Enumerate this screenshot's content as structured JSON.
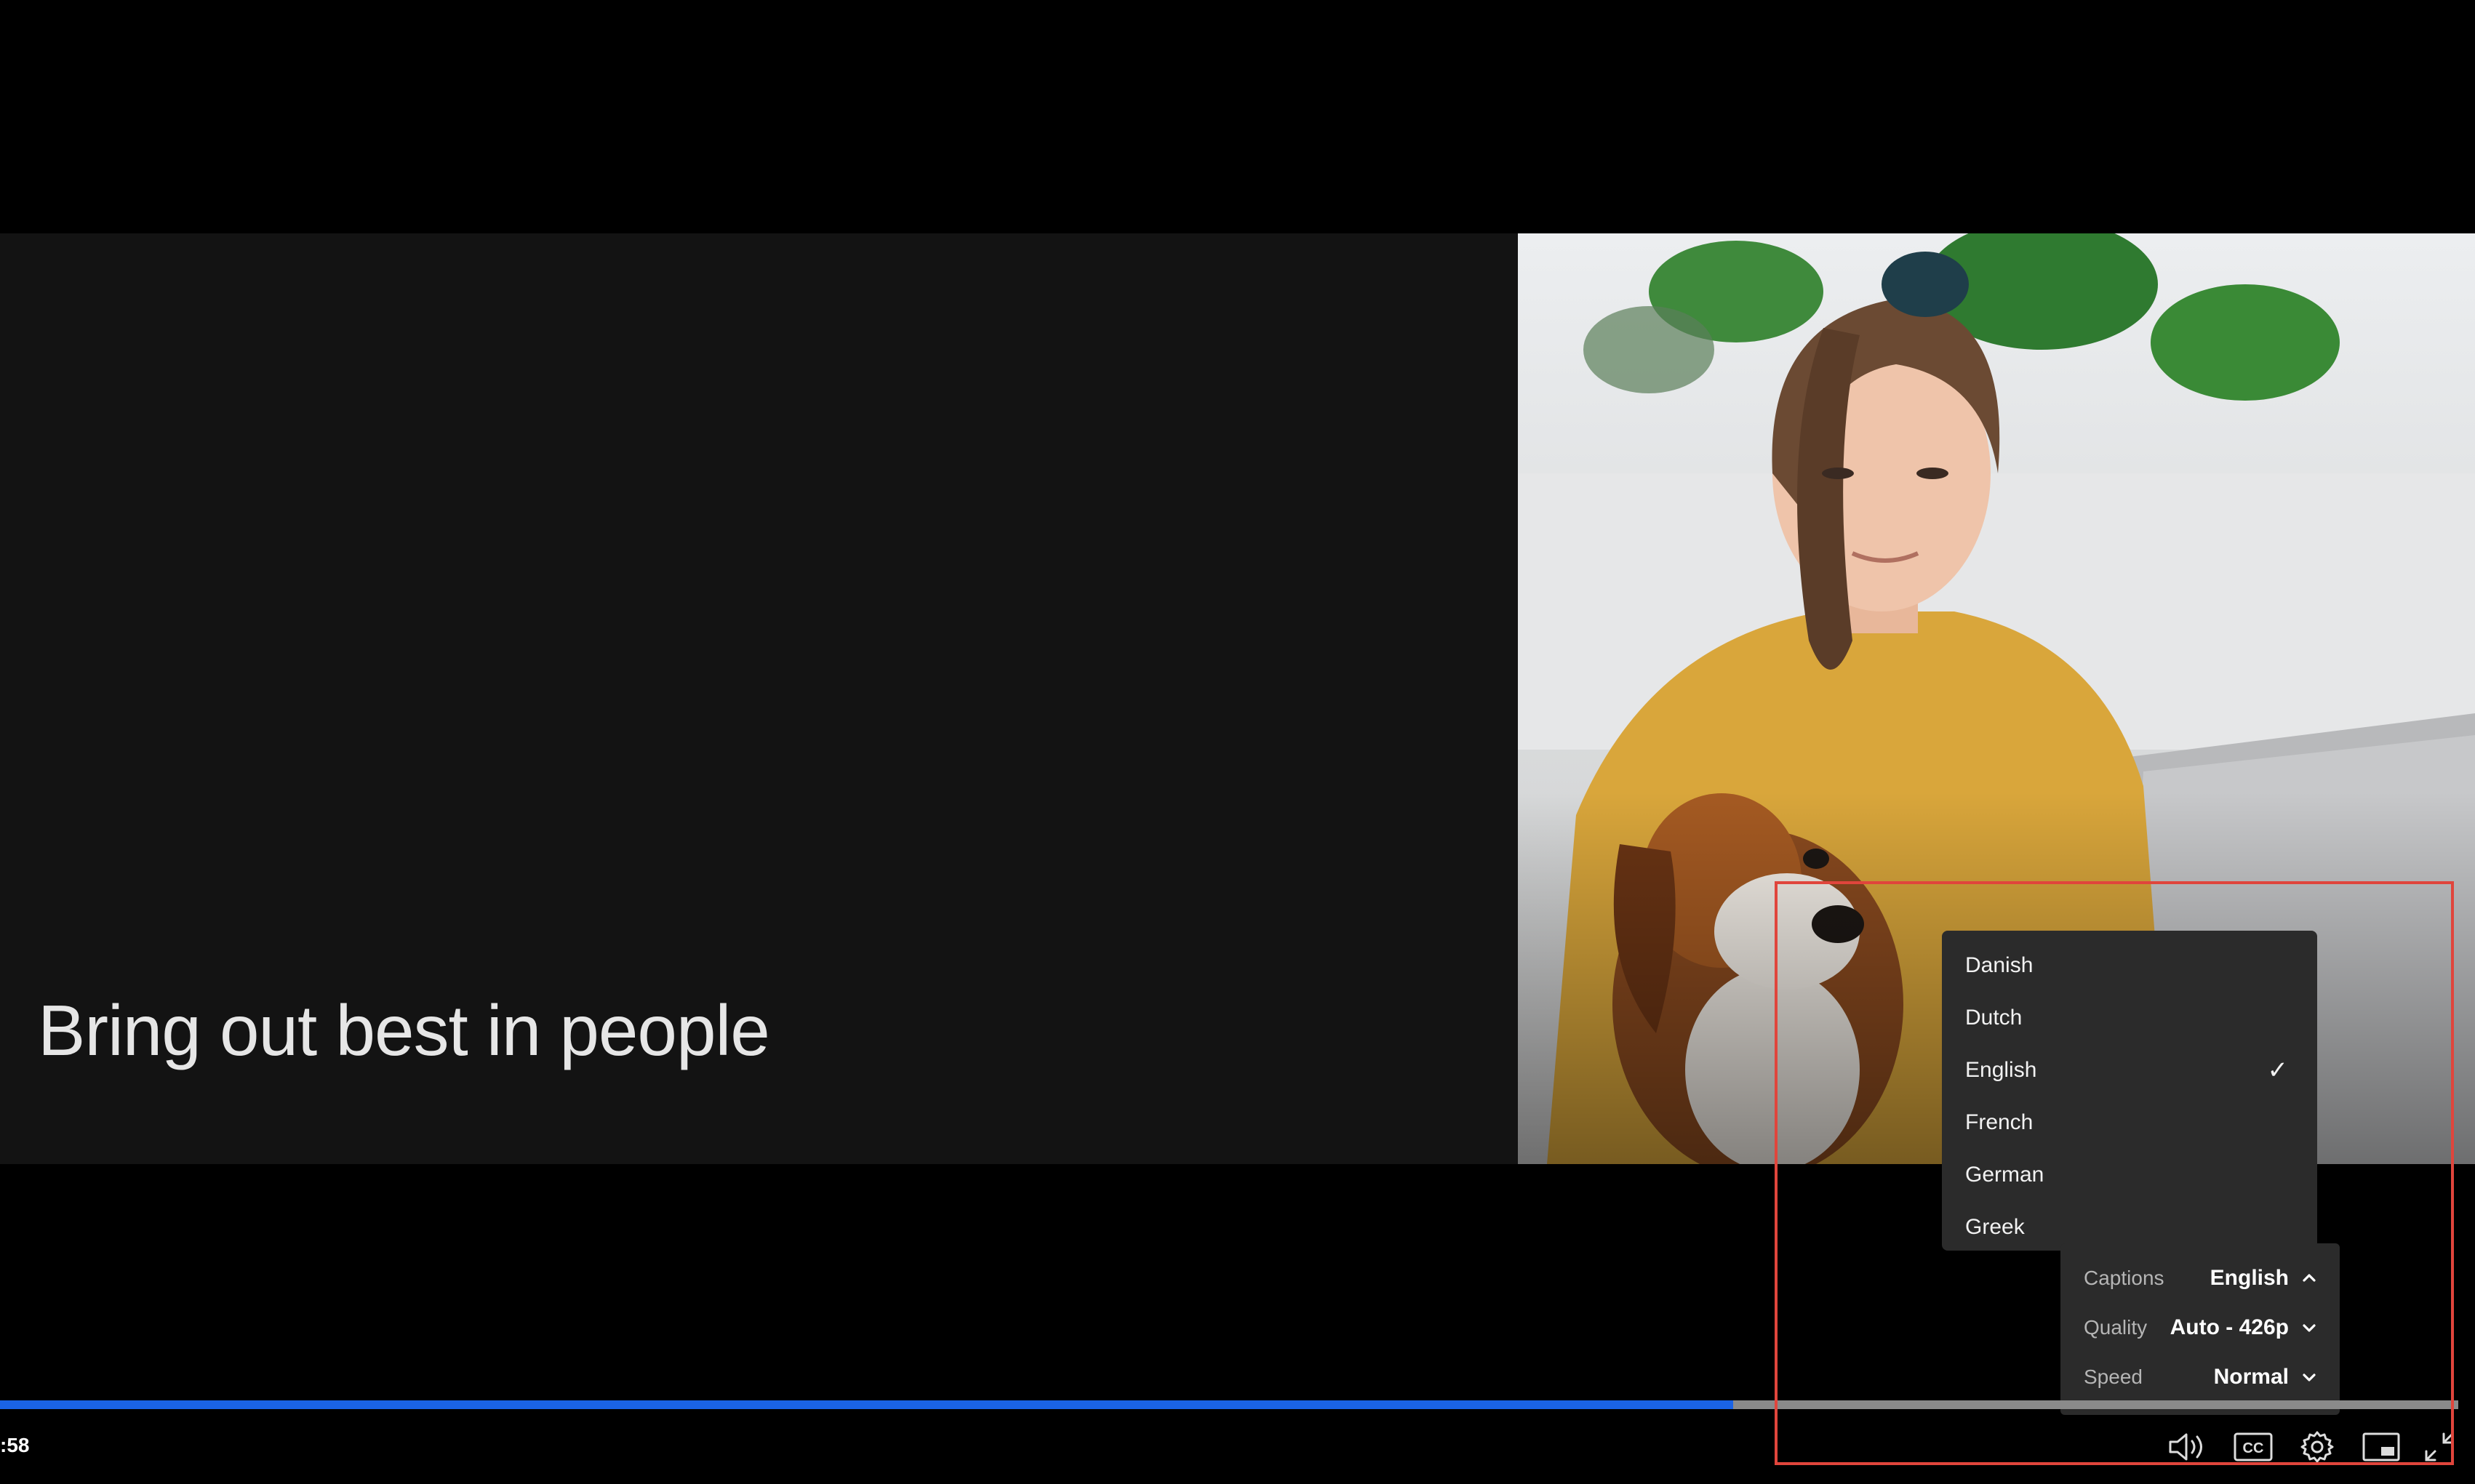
{
  "slide": {
    "text": "Bring out best in people"
  },
  "captions_menu": {
    "languages": [
      {
        "label": "Danish",
        "selected": false
      },
      {
        "label": "Dutch",
        "selected": false
      },
      {
        "label": "English",
        "selected": true
      },
      {
        "label": "French",
        "selected": false
      },
      {
        "label": "German",
        "selected": false
      },
      {
        "label": "Greek",
        "selected": false
      }
    ],
    "check_glyph": "✓"
  },
  "settings": {
    "captions": {
      "label": "Captions",
      "value": "English",
      "chevron": "chevron-up-icon"
    },
    "quality": {
      "label": "Quality",
      "value": "Auto - 426p",
      "chevron": "chevron-down-icon"
    },
    "speed": {
      "label": "Speed",
      "value": "Normal",
      "chevron": "chevron-down-icon"
    }
  },
  "playback": {
    "time": ":58",
    "progress_fraction": 0.705
  },
  "controls": {
    "icons": [
      "volume-icon",
      "closed-captions-icon",
      "settings-gear-icon",
      "picture-in-picture-icon",
      "exit-fullscreen-icon"
    ],
    "cc_label": "CC"
  },
  "colors": {
    "progress": "#1a63e6",
    "highlight": "#e0453c",
    "menu_bg": "#2b2b2b"
  }
}
